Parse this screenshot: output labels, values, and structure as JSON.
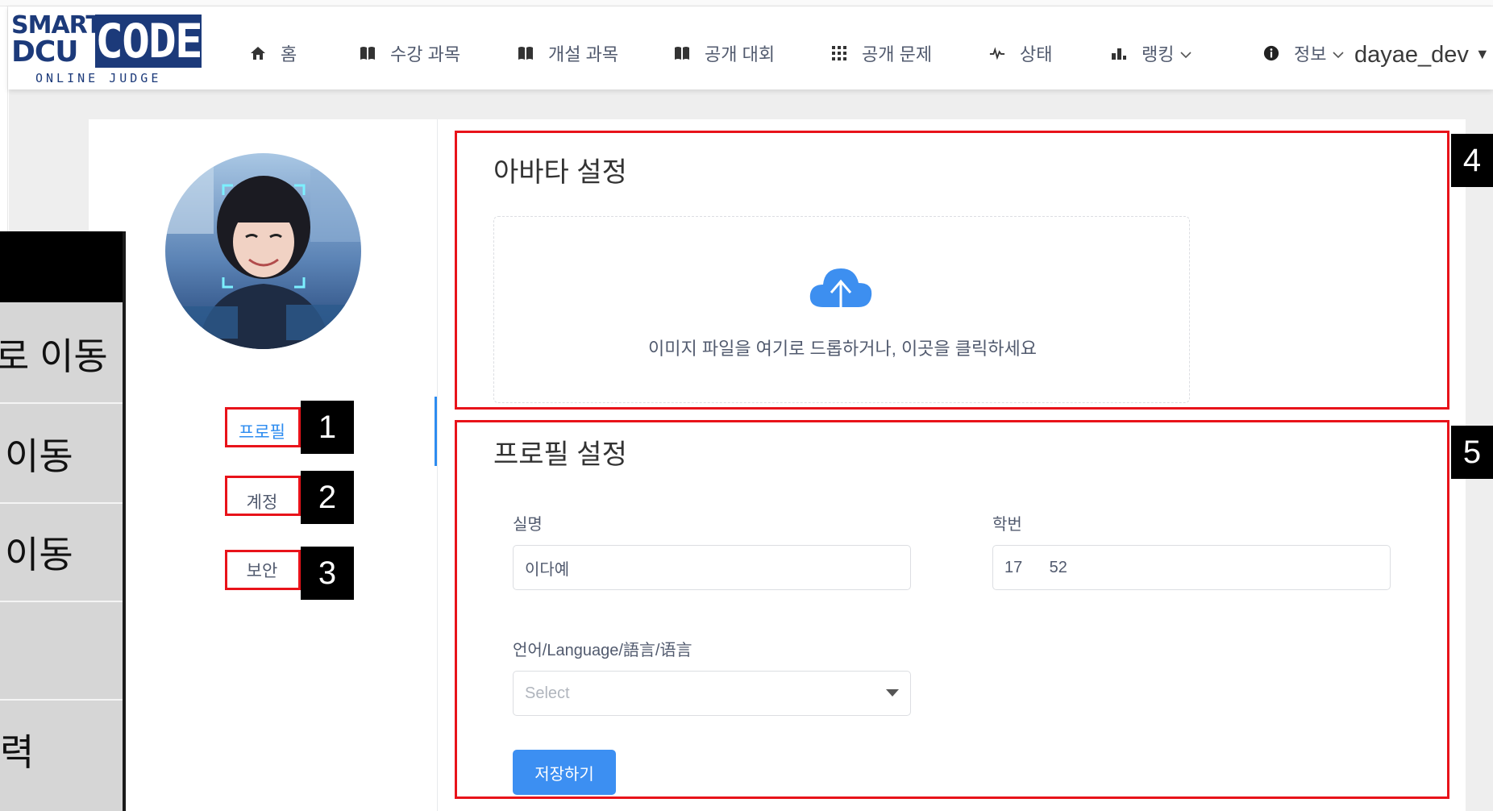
{
  "logo": {
    "line1": "SMART",
    "line2": "DCU",
    "code": "CODE",
    "subtitle": "ONLINE JUDGE"
  },
  "nav": {
    "items": [
      {
        "icon": "home-icon",
        "label": "홈"
      },
      {
        "icon": "book-icon",
        "label": "수강 과목"
      },
      {
        "icon": "book-icon",
        "label": "개설 과목"
      },
      {
        "icon": "book-icon",
        "label": "공개 대회"
      },
      {
        "icon": "grid-icon",
        "label": "공개 문제"
      },
      {
        "icon": "pulse-icon",
        "label": "상태"
      },
      {
        "icon": "bar-chart-icon",
        "label": "랭킹"
      },
      {
        "icon": "info-icon",
        "label": "정보"
      }
    ],
    "user": "dayae_dev"
  },
  "side_menu": {
    "profile": "프로필",
    "account": "계정",
    "security": "보안"
  },
  "overlay": {
    "rows": [
      "로 이동",
      "이동",
      "이동",
      "",
      "력"
    ]
  },
  "annotations": [
    "1",
    "2",
    "3",
    "4",
    "5"
  ],
  "avatar_section": {
    "title": "아바타 설정",
    "upload_text": "이미지 파일을 여기로 드롭하거나, 이곳을 클릭하세요"
  },
  "profile_section": {
    "title": "프로필 설정",
    "real_name_label": "실명",
    "real_name_value": "이다예",
    "student_id_label": "학번",
    "student_id_value": "17      52",
    "language_label": "언어/Language/語言/语言",
    "language_placeholder": "Select",
    "save_label": "저장하기"
  },
  "colors": {
    "brand": "#1c3a7a",
    "accent": "#2d8cf0",
    "annotation": "#e8131a",
    "button": "#3c8ff2"
  }
}
